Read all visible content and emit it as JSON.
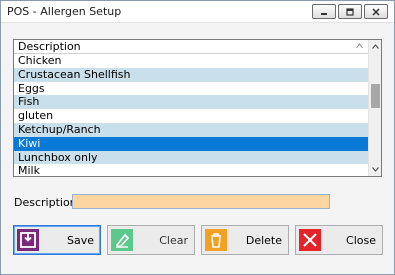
{
  "window": {
    "title": "POS - Allergen Setup",
    "controls": [
      "minimize-icon",
      "restore-icon",
      "close-icon"
    ]
  },
  "list": {
    "column_header": "Description",
    "items": [
      {
        "label": "Chicken"
      },
      {
        "label": "Crustacean Shellfish"
      },
      {
        "label": "Eggs"
      },
      {
        "label": "Fish"
      },
      {
        "label": "gluten"
      },
      {
        "label": "Ketchup/Ranch"
      },
      {
        "label": "Kiwi"
      },
      {
        "label": "Lunchbox only"
      },
      {
        "label": "Milk"
      }
    ],
    "selected_index": 6
  },
  "form": {
    "description_label": "Description:",
    "description_value": ""
  },
  "buttons": {
    "save": "Save",
    "clear": "Clear",
    "delete": "Delete",
    "close": "Close"
  },
  "colors": {
    "row_alt": "#c9dfeb",
    "row_selected": "#0a7ad6",
    "input_bg": "#fcd5a0",
    "save_icon": "#7a2a7a",
    "clear_icon": "#5cc98c",
    "delete_icon": "#f2a023",
    "close_icon": "#e3242b"
  }
}
